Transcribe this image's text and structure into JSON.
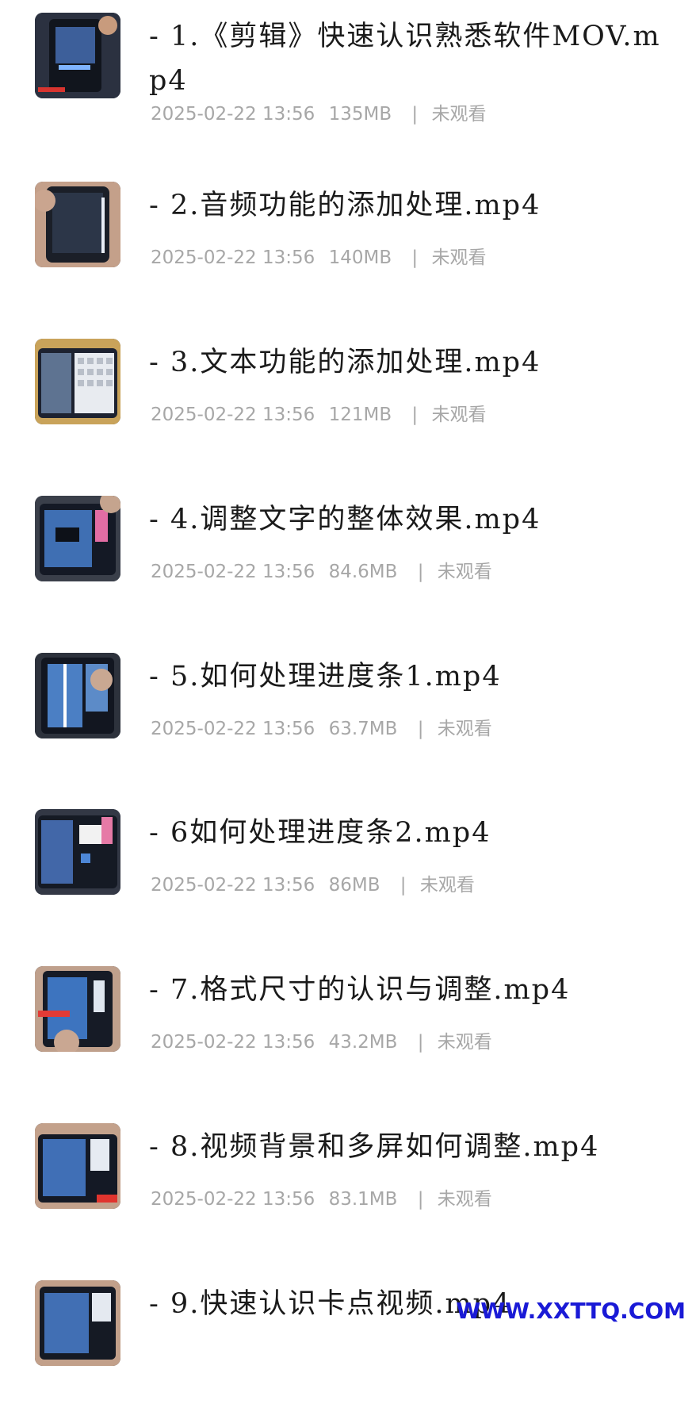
{
  "files": [
    {
      "name": "- 1.《剪辑》快速认识熟悉软件MOV.mp4",
      "date": "2025-02-22 13:56",
      "size": "135MB",
      "status": "未观看",
      "thumb_icon": "video-thumbnail-icon"
    },
    {
      "name": "- 2.音频功能的添加处理.mp4",
      "date": "2025-02-22 13:56",
      "size": "140MB",
      "status": "未观看",
      "thumb_icon": "video-thumbnail-icon"
    },
    {
      "name": "- 3.文本功能的添加处理.mp4",
      "date": "2025-02-22 13:56",
      "size": "121MB",
      "status": "未观看",
      "thumb_icon": "video-thumbnail-icon"
    },
    {
      "name": "- 4.调整文字的整体效果.mp4",
      "date": "2025-02-22 13:56",
      "size": "84.6MB",
      "status": "未观看",
      "thumb_icon": "video-thumbnail-icon"
    },
    {
      "name": "- 5.如何处理进度条1.mp4",
      "date": "2025-02-22 13:56",
      "size": "63.7MB",
      "status": "未观看",
      "thumb_icon": "video-thumbnail-icon"
    },
    {
      "name": "- 6如何处理进度条2.mp4",
      "date": "2025-02-22 13:56",
      "size": "86MB",
      "status": "未观看",
      "thumb_icon": "video-thumbnail-icon"
    },
    {
      "name": "- 7.格式尺寸的认识与调整.mp4",
      "date": "2025-02-22 13:56",
      "size": "43.2MB",
      "status": "未观看",
      "thumb_icon": "video-thumbnail-icon"
    },
    {
      "name": "- 8.视频背景和多屏如何调整.mp4",
      "date": "2025-02-22 13:56",
      "size": "83.1MB",
      "status": "未观看",
      "thumb_icon": "video-thumbnail-icon"
    },
    {
      "name": "- 9.快速认识卡点视频.mp4",
      "date": "",
      "size": "",
      "status": "",
      "thumb_icon": "video-thumbnail-icon"
    }
  ],
  "separator": "|",
  "watermark": "WWW.XXTTQ.COM"
}
